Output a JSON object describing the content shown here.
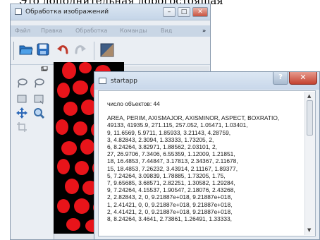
{
  "top_text": "Это дополнительная дорогостоящая",
  "main_window": {
    "title": "Обработка изображений",
    "buttons": {
      "minimize": "–",
      "maximize": "□",
      "close": "✕"
    },
    "menu": [
      "Файл",
      "Правка",
      "Обработка",
      "Команды",
      "Вид"
    ],
    "menu_overflow": "»",
    "toolbar_icons": [
      "folder-open-icon",
      "save-icon",
      "undo-arrow-icon",
      "redo-arrow-icon",
      "image-thumbnail-icon"
    ],
    "tool_icons": [
      "lasso-icon",
      "lasso-icon",
      "rect-select-icon",
      "rect-select-icon",
      "move-icon",
      "zoom-icon",
      "crop-icon"
    ]
  },
  "startapp_window": {
    "title": "startapp",
    "help_label": "?",
    "close_label": "✕",
    "object_count_line": "число объектов: 44",
    "header_line": "AREA, PERIM, AXISMAJOR, AXISMINOR, ASPECT, BOXRATIO,",
    "data_lines": [
      "49133, 41935.9, 271.115, 257.052, 1.05471, 1.03401,",
      "9, 11.6569, 5.9711, 1.85933, 3.21143, 4.28759,",
      "3, 4.82843, 2.3094, 1.33333, 1.73205, 2,",
      "6, 8.24264, 3.82971, 1.88562, 2.03101, 2,",
      "27, 26.9706, 7.3406, 6.55359, 1.12009, 1.21851,",
      "18, 16.4853, 7.44847, 3.17813, 2.34367, 2.11678,",
      "15, 18.4853, 7.26232, 3.43914, 2.11167, 1.89377,",
      "5, 7.24264, 3.09839, 1.78885, 1.73205, 1.75,",
      "7, 9.65685, 3.68571, 2.82251, 1.30582, 1.29284,",
      "9, 7.24264, 4.15537, 1.90547, 2.18076, 2.43268,",
      "2, 2.82843, 2, 0, 9.21887e+018, 9.21887e+018,",
      "1, 2.41421, 0, 0, 9.21887e+018, 9.21887e+018,",
      "2, 4.41421, 2, 0, 9.21887e+018, 9.21887e+018,",
      "8, 8.24264, 3.4641, 2.73861, 1.26491, 1.33333,"
    ]
  },
  "colors": {
    "blob_red": "#e8141a",
    "image_background": "#000000",
    "menubar": "#c9d6e5",
    "window_frame": "#8397ad"
  }
}
